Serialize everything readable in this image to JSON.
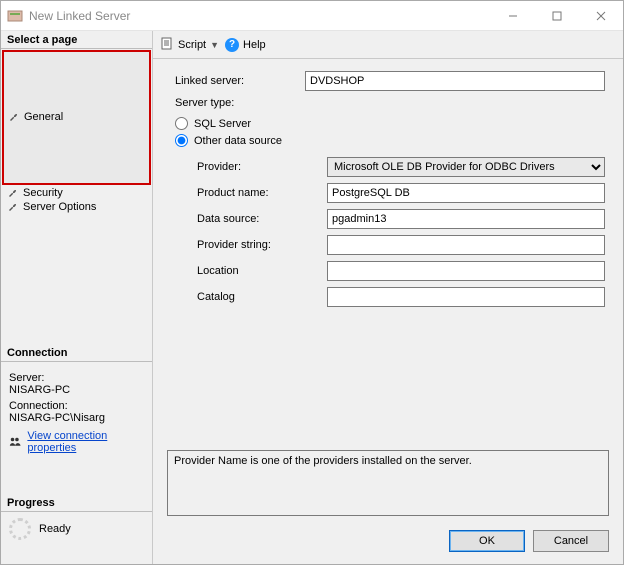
{
  "window": {
    "title": "New Linked Server"
  },
  "left": {
    "select_page": "Select a page",
    "nav": {
      "general": "General",
      "security": "Security",
      "server_options": "Server Options"
    },
    "connection_hdr": "Connection",
    "server_lbl": "Server:",
    "server_val": "NISARG-PC",
    "conn_lbl": "Connection:",
    "conn_val": "NISARG-PC\\Nisarg",
    "view_props": "View connection properties",
    "progress_hdr": "Progress",
    "progress_state": "Ready"
  },
  "toolbar": {
    "script": "Script",
    "help": "Help"
  },
  "form": {
    "linked_server_lbl": "Linked server:",
    "linked_server_val": "DVDSHOP",
    "server_type_lbl": "Server type:",
    "radio_sql": "SQL Server",
    "radio_other": "Other data source",
    "provider_lbl": "Provider:",
    "provider_val": "Microsoft OLE DB Provider for ODBC Drivers",
    "product_lbl": "Product name:",
    "product_val": "PostgreSQL DB",
    "datasource_lbl": "Data source:",
    "datasource_val": "pgadmin13",
    "providerstr_lbl": "Provider string:",
    "providerstr_val": "",
    "location_lbl": "Location",
    "location_val": "",
    "catalog_lbl": "Catalog",
    "catalog_val": ""
  },
  "info": "Provider Name is one of the providers installed on the server.",
  "buttons": {
    "ok": "OK",
    "cancel": "Cancel"
  }
}
